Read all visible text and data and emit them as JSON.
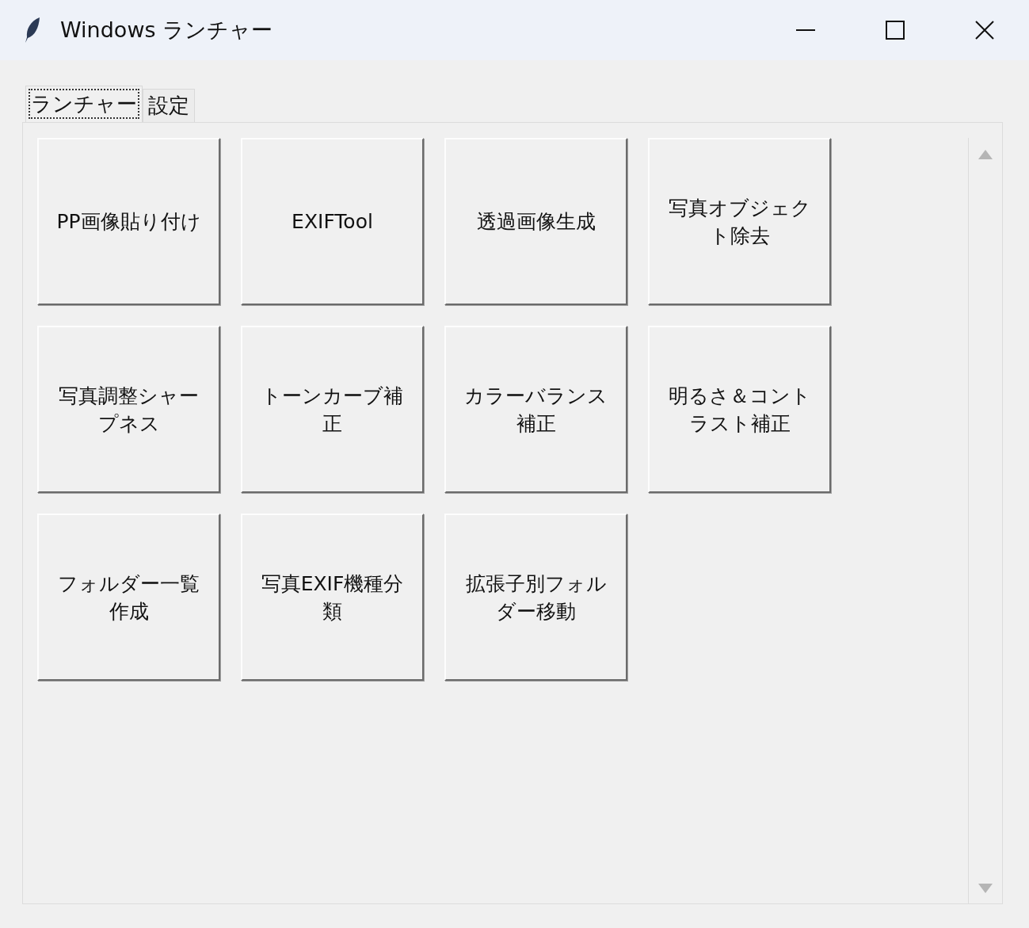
{
  "window": {
    "title": "Windows ランチャー"
  },
  "tabs": [
    {
      "label": "ランチャー",
      "selected": true
    },
    {
      "label": "設定",
      "selected": false
    }
  ],
  "buttons": [
    "PP画像貼り付け",
    "EXIFTool",
    "透過画像生成",
    "写真オブジェクト除去",
    "写真調整シャープネス",
    "トーンカーブ補正",
    "カラーバランス補正",
    "明るさ＆コントラスト補正",
    "フォルダー一覧作成",
    "写真EXIF機種分類",
    "拡張子別フォルダー移動"
  ]
}
